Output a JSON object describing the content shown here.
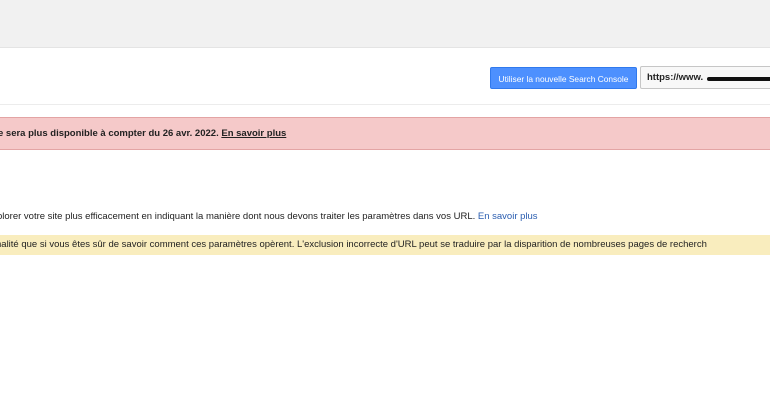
{
  "header": {
    "new_search_console_button": "Utiliser la nouvelle Search Console",
    "site_url_prefix": "https://www."
  },
  "deprecation_banner": {
    "text": "e sera plus disponible à compter du 26 avr. 2022.",
    "link": "En savoir plus"
  },
  "intro": {
    "text": "plorer votre site plus efficacement en indiquant la manière dont nous devons traiter les paramètres dans vos URL.",
    "link": "En savoir plus"
  },
  "warning_banner": {
    "text": "nalité que si vous êtes sûr de savoir comment ces paramètres opèrent. L'exclusion incorrecte d'URL peut se traduire par la disparition de nombreuses pages de recherch"
  },
  "colors": {
    "primary_button": "#4d90fe",
    "deprecation_background": "#f5c9c9",
    "warning_background": "#f9edbe",
    "link": "#2a5db0"
  }
}
